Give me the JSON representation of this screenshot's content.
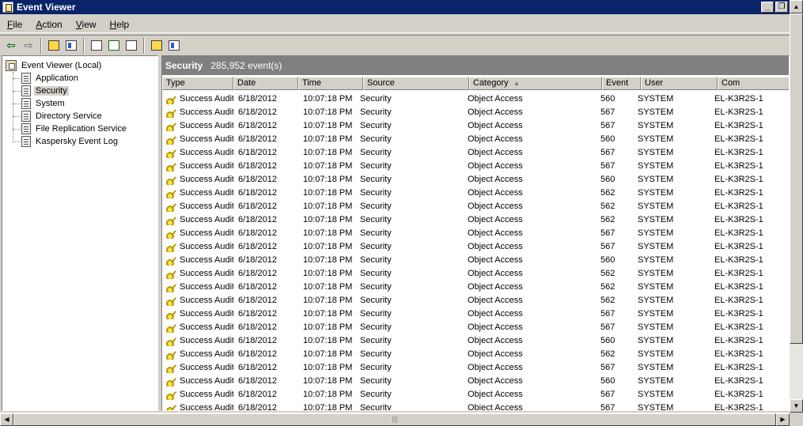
{
  "window": {
    "title": "Event Viewer"
  },
  "menu": [
    {
      "label": "File",
      "accel": "F",
      "rest": "ile"
    },
    {
      "label": "Action",
      "accel": "A",
      "rest": "ction"
    },
    {
      "label": "View",
      "accel": "V",
      "rest": "iew"
    },
    {
      "label": "Help",
      "accel": "H",
      "rest": "elp"
    }
  ],
  "tree": {
    "root": "Event Viewer (Local)",
    "items": [
      "Application",
      "Security",
      "System",
      "Directory Service",
      "File Replication Service",
      "Kaspersky Event Log"
    ],
    "selected": "Security"
  },
  "list": {
    "log_name": "Security",
    "count": "285,952 event(s)",
    "columns": [
      "Type",
      "Date",
      "Time",
      "Source",
      "Category",
      "Event",
      "User",
      "Com"
    ],
    "sorted_column": "Category",
    "rows": [
      [
        "Success Audit",
        "6/18/2012",
        "10:07:18 PM",
        "Security",
        "Object Access",
        "560",
        "SYSTEM",
        "EL-K3R2S-1"
      ],
      [
        "Success Audit",
        "6/18/2012",
        "10:07:18 PM",
        "Security",
        "Object Access",
        "567",
        "SYSTEM",
        "EL-K3R2S-1"
      ],
      [
        "Success Audit",
        "6/18/2012",
        "10:07:18 PM",
        "Security",
        "Object Access",
        "567",
        "SYSTEM",
        "EL-K3R2S-1"
      ],
      [
        "Success Audit",
        "6/18/2012",
        "10:07:18 PM",
        "Security",
        "Object Access",
        "560",
        "SYSTEM",
        "EL-K3R2S-1"
      ],
      [
        "Success Audit",
        "6/18/2012",
        "10:07:18 PM",
        "Security",
        "Object Access",
        "567",
        "SYSTEM",
        "EL-K3R2S-1"
      ],
      [
        "Success Audit",
        "6/18/2012",
        "10:07:18 PM",
        "Security",
        "Object Access",
        "567",
        "SYSTEM",
        "EL-K3R2S-1"
      ],
      [
        "Success Audit",
        "6/18/2012",
        "10:07:18 PM",
        "Security",
        "Object Access",
        "560",
        "SYSTEM",
        "EL-K3R2S-1"
      ],
      [
        "Success Audit",
        "6/18/2012",
        "10:07:18 PM",
        "Security",
        "Object Access",
        "562",
        "SYSTEM",
        "EL-K3R2S-1"
      ],
      [
        "Success Audit",
        "6/18/2012",
        "10:07:18 PM",
        "Security",
        "Object Access",
        "562",
        "SYSTEM",
        "EL-K3R2S-1"
      ],
      [
        "Success Audit",
        "6/18/2012",
        "10:07:18 PM",
        "Security",
        "Object Access",
        "562",
        "SYSTEM",
        "EL-K3R2S-1"
      ],
      [
        "Success Audit",
        "6/18/2012",
        "10:07:18 PM",
        "Security",
        "Object Access",
        "567",
        "SYSTEM",
        "EL-K3R2S-1"
      ],
      [
        "Success Audit",
        "6/18/2012",
        "10:07:18 PM",
        "Security",
        "Object Access",
        "567",
        "SYSTEM",
        "EL-K3R2S-1"
      ],
      [
        "Success Audit",
        "6/18/2012",
        "10:07:18 PM",
        "Security",
        "Object Access",
        "560",
        "SYSTEM",
        "EL-K3R2S-1"
      ],
      [
        "Success Audit",
        "6/18/2012",
        "10:07:18 PM",
        "Security",
        "Object Access",
        "562",
        "SYSTEM",
        "EL-K3R2S-1"
      ],
      [
        "Success Audit",
        "6/18/2012",
        "10:07:18 PM",
        "Security",
        "Object Access",
        "562",
        "SYSTEM",
        "EL-K3R2S-1"
      ],
      [
        "Success Audit",
        "6/18/2012",
        "10:07:18 PM",
        "Security",
        "Object Access",
        "562",
        "SYSTEM",
        "EL-K3R2S-1"
      ],
      [
        "Success Audit",
        "6/18/2012",
        "10:07:18 PM",
        "Security",
        "Object Access",
        "567",
        "SYSTEM",
        "EL-K3R2S-1"
      ],
      [
        "Success Audit",
        "6/18/2012",
        "10:07:18 PM",
        "Security",
        "Object Access",
        "567",
        "SYSTEM",
        "EL-K3R2S-1"
      ],
      [
        "Success Audit",
        "6/18/2012",
        "10:07:18 PM",
        "Security",
        "Object Access",
        "560",
        "SYSTEM",
        "EL-K3R2S-1"
      ],
      [
        "Success Audit",
        "6/18/2012",
        "10:07:18 PM",
        "Security",
        "Object Access",
        "562",
        "SYSTEM",
        "EL-K3R2S-1"
      ],
      [
        "Success Audit",
        "6/18/2012",
        "10:07:18 PM",
        "Security",
        "Object Access",
        "567",
        "SYSTEM",
        "EL-K3R2S-1"
      ],
      [
        "Success Audit",
        "6/18/2012",
        "10:07:18 PM",
        "Security",
        "Object Access",
        "560",
        "SYSTEM",
        "EL-K3R2S-1"
      ],
      [
        "Success Audit",
        "6/18/2012",
        "10:07:18 PM",
        "Security",
        "Object Access",
        "567",
        "SYSTEM",
        "EL-K3R2S-1"
      ],
      [
        "Success Audit",
        "6/18/2012",
        "10:07:18 PM",
        "Security",
        "Object Access",
        "567",
        "SYSTEM",
        "EL-K3R2S-1"
      ]
    ]
  },
  "colors": {
    "titlebar": "#0a246a",
    "list_header": "#808080",
    "chrome": "#d4d0c8"
  },
  "icons": {
    "row_type": "key-icon",
    "toolbar": [
      "back-arrow-icon",
      "forward-arrow-icon",
      "up-folder-icon",
      "show-hide-tree-icon",
      "properties-icon",
      "refresh-icon",
      "export-list-icon",
      "help-icon",
      "console-icon"
    ]
  }
}
